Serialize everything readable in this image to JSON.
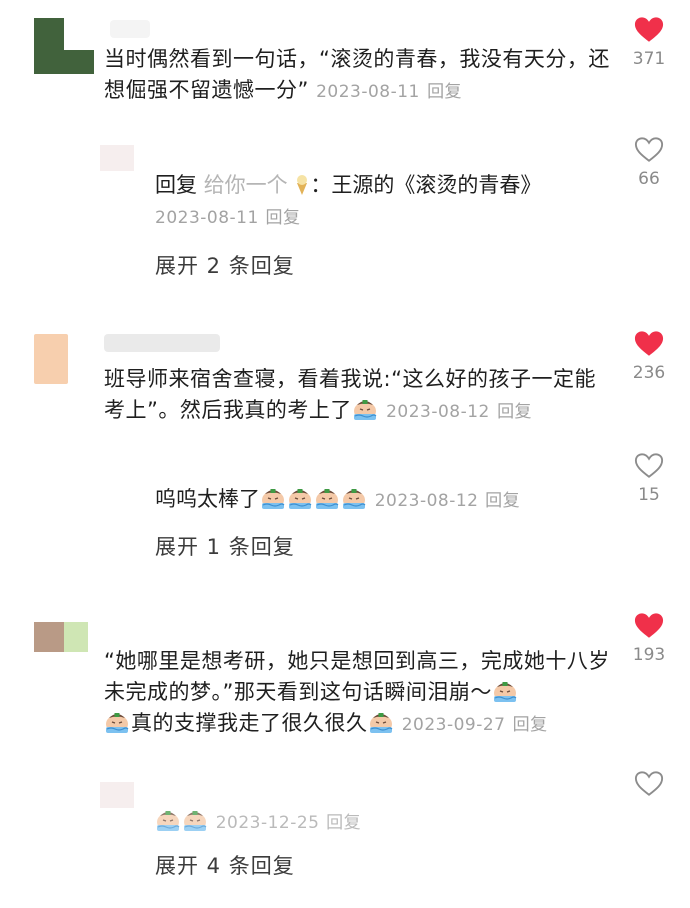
{
  "comments": [
    {
      "text": "当时偶然看到一句话，“滚烫的青春，我没有天分，还想倔强不留遗憾一分”",
      "date": "2023-08-11",
      "reply_label": "回复",
      "likes": "371",
      "liked": true,
      "reply": {
        "prefix": "回复",
        "to_user": "给你一个",
        "text": "：王源的《滚烫的青春》",
        "date": "2023-08-11",
        "reply_label": "回复",
        "likes": "66",
        "liked": false
      },
      "expand": "展开 2 条回复"
    },
    {
      "text": "班导师来宿舍查寝，看着我说:“这么好的孩子一定能考上”。然后我真的考上了",
      "date": "2023-08-12",
      "reply_label": "回复",
      "likes": "236",
      "liked": true,
      "reply": {
        "text": "呜呜太棒了",
        "date": "2023-08-12",
        "reply_label": "回复",
        "likes": "15",
        "liked": false
      },
      "expand": "展开 1 条回复"
    },
    {
      "text": "“她哪里是想考研，她只是想回到高三，完成她十八岁未完成的梦。”那天看到这句话瞬间泪崩～",
      "text2": "真的支撑我走了很久很久",
      "date": "2023-09-27",
      "reply_label": "回复",
      "likes": "193",
      "liked": true,
      "reply": {
        "date": "2023-12-25",
        "reply_label": "回复",
        "liked": false
      },
      "expand": "展开 4 条回复"
    }
  ],
  "colors": {
    "heart_liked": "#f0304a",
    "heart_outline": "#8c8c8c",
    "meta": "#a3a3a3"
  },
  "icons": {
    "like_filled": "heart-filled-icon",
    "like_outline": "heart-outline-icon",
    "emoji": "crying-emoji-icon",
    "ice_cream": "ice-cream-icon"
  }
}
